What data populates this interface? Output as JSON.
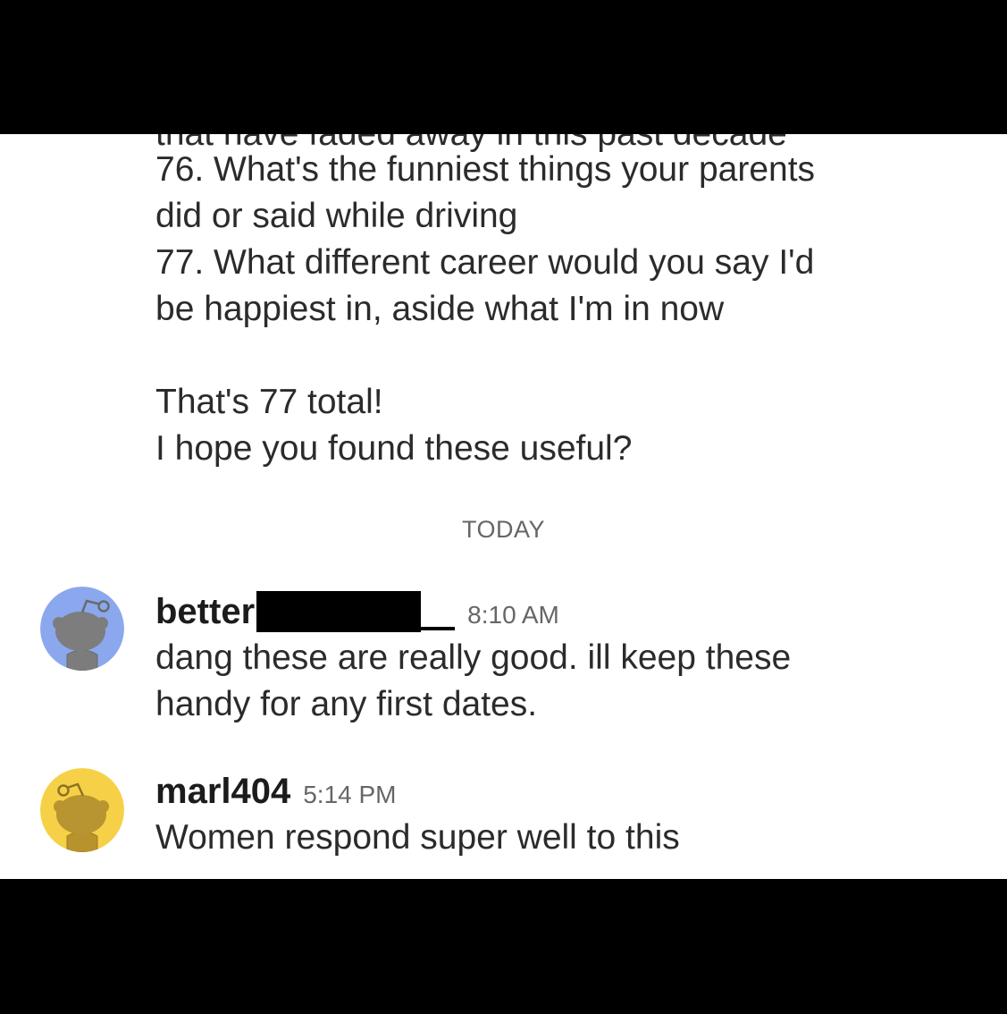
{
  "conversation": {
    "previous_message": {
      "cut_line": "that have faded away in this past decade",
      "lines": [
        "76. What's the funniest things your parents",
        "did or said while driving",
        "77. What different career would you say I'd",
        "be happiest in, aside what I'm in now",
        "",
        "That's 77 total!",
        "I hope you found these useful?"
      ]
    },
    "day_divider": "TODAY",
    "messages": [
      {
        "username": "better",
        "username_suffix": "_",
        "time": "8:10 AM",
        "lines": [
          "dang these are really good. ill keep these",
          "handy for any first dates."
        ],
        "avatar_color": "#8ba8ef"
      },
      {
        "username": "marl404",
        "time": "5:14 PM",
        "lines": [
          "Women respond super well to this"
        ],
        "avatar_color": "#f6d147"
      }
    ]
  },
  "colors": {
    "text": "#2b2b2b",
    "muted": "#666666",
    "background": "#ffffff",
    "letterbox": "#000000"
  },
  "icons": {
    "avatar": "snoo-avatar-icon"
  }
}
